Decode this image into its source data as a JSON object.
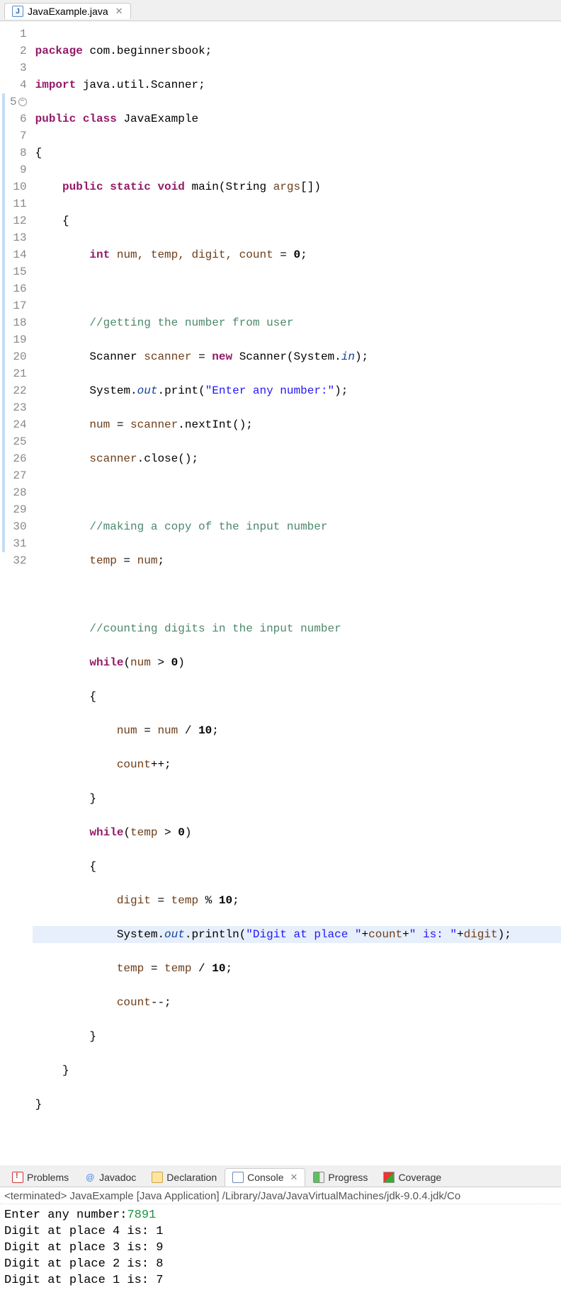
{
  "editor": {
    "tab_filename": "JavaExample.java",
    "line_numbers": [
      "1",
      "2",
      "3",
      "4",
      "5",
      "6",
      "7",
      "8",
      "9",
      "10",
      "11",
      "12",
      "13",
      "14",
      "15",
      "16",
      "17",
      "18",
      "19",
      "20",
      "21",
      "22",
      "23",
      "24",
      "25",
      "26",
      "27",
      "28",
      "29",
      "30",
      "31",
      "32"
    ],
    "pkg_kw": "package",
    "pkg_name": "com.beginnersbook",
    "import_kw": "import",
    "import_name": "java.util.Scanner",
    "public_kw": "public",
    "class_kw": "class",
    "class_name": "JavaExample",
    "static_kw": "static",
    "void_kw": "void",
    "main_name": "main",
    "string_type": "String",
    "args_name": "args",
    "int_kw": "int",
    "vars_decl": "num, temp, digit, count",
    "zero": "0",
    "c_getnum": "//getting the number from user",
    "scanner_type": "Scanner",
    "scanner_var": "scanner",
    "new_kw": "new",
    "system_type": "System",
    "in_field": "in",
    "out_field": "out",
    "print_method": "print",
    "println_method": "println",
    "prompt_string": "\"Enter any number:\"",
    "nextInt": "nextInt",
    "close_method": "close",
    "c_copy": "//making a copy of the input number",
    "temp_var": "temp",
    "num_var": "num",
    "c_count": "//counting digits in the input number",
    "while_kw": "while",
    "ten": "10",
    "count_var": "count",
    "digit_var": "digit",
    "digit_string1": "\"Digit at place \"",
    "digit_string2": "\" is: \""
  },
  "bottom_tabs": {
    "problems": "Problems",
    "javadoc": "Javadoc",
    "declaration": "Declaration",
    "console": "Console",
    "progress": "Progress",
    "coverage": "Coverage"
  },
  "console": {
    "meta": "<terminated> JavaExample [Java Application] /Library/Java/JavaVirtualMachines/jdk-9.0.4.jdk/Co",
    "prompt": "Enter any number:",
    "user_input": "7891",
    "lines": [
      "Digit at place 4 is: 1",
      "Digit at place 3 is: 9",
      "Digit at place 2 is: 8",
      "Digit at place 1 is: 7"
    ]
  }
}
